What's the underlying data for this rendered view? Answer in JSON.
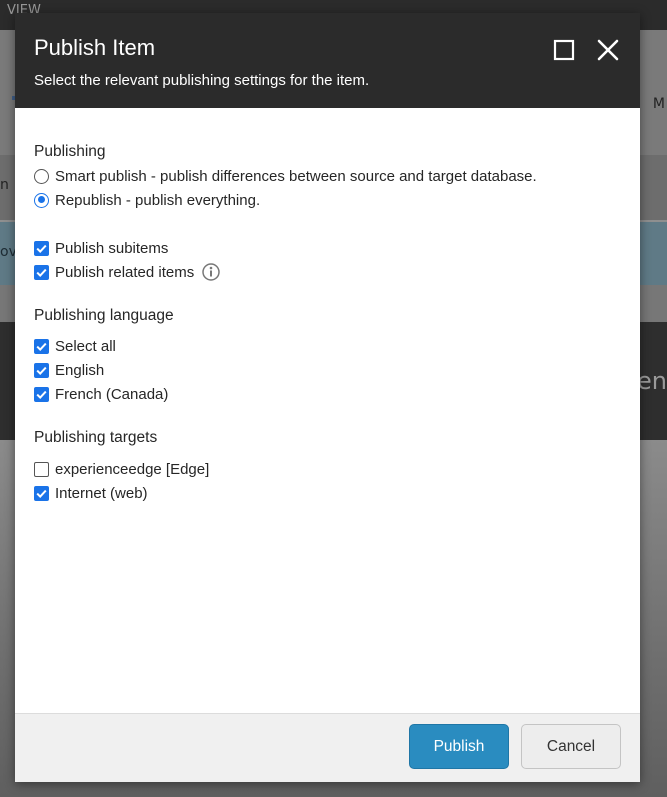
{
  "background": {
    "menu_label": "VIEW",
    "ribbon_edge_text": "M",
    "strip_edge_text": "n",
    "notice_edge_text": "ov",
    "banner_edge_text": "en"
  },
  "dialog": {
    "title": "Publish Item",
    "subtitle": "Select the relevant publishing settings for the item.",
    "header_icons": [
      "maximize-icon",
      "close-icon"
    ],
    "publishing": {
      "title": "Publishing",
      "options": [
        {
          "label": "Smart publish - publish differences between source and target database.",
          "selected": false
        },
        {
          "label": "Republish - publish everything.",
          "selected": true
        }
      ],
      "subitems_label": "Publish subitems",
      "subitems_checked": true,
      "related_label": "Publish related items",
      "related_checked": true
    },
    "language": {
      "title": "Publishing language",
      "items": [
        {
          "label": "Select all",
          "checked": true
        },
        {
          "label": "English",
          "checked": true
        },
        {
          "label": "French (Canada)",
          "checked": true
        }
      ]
    },
    "targets": {
      "title": "Publishing targets",
      "items": [
        {
          "label": "experienceedge [Edge]",
          "checked": false
        },
        {
          "label": "Internet (web)",
          "checked": true
        }
      ]
    },
    "footer": {
      "publish_label": "Publish",
      "cancel_label": "Cancel"
    }
  },
  "colors": {
    "header_bg": "#2b2b2b",
    "accent": "#1a73e8",
    "primary_button": "#2a8cc0"
  }
}
